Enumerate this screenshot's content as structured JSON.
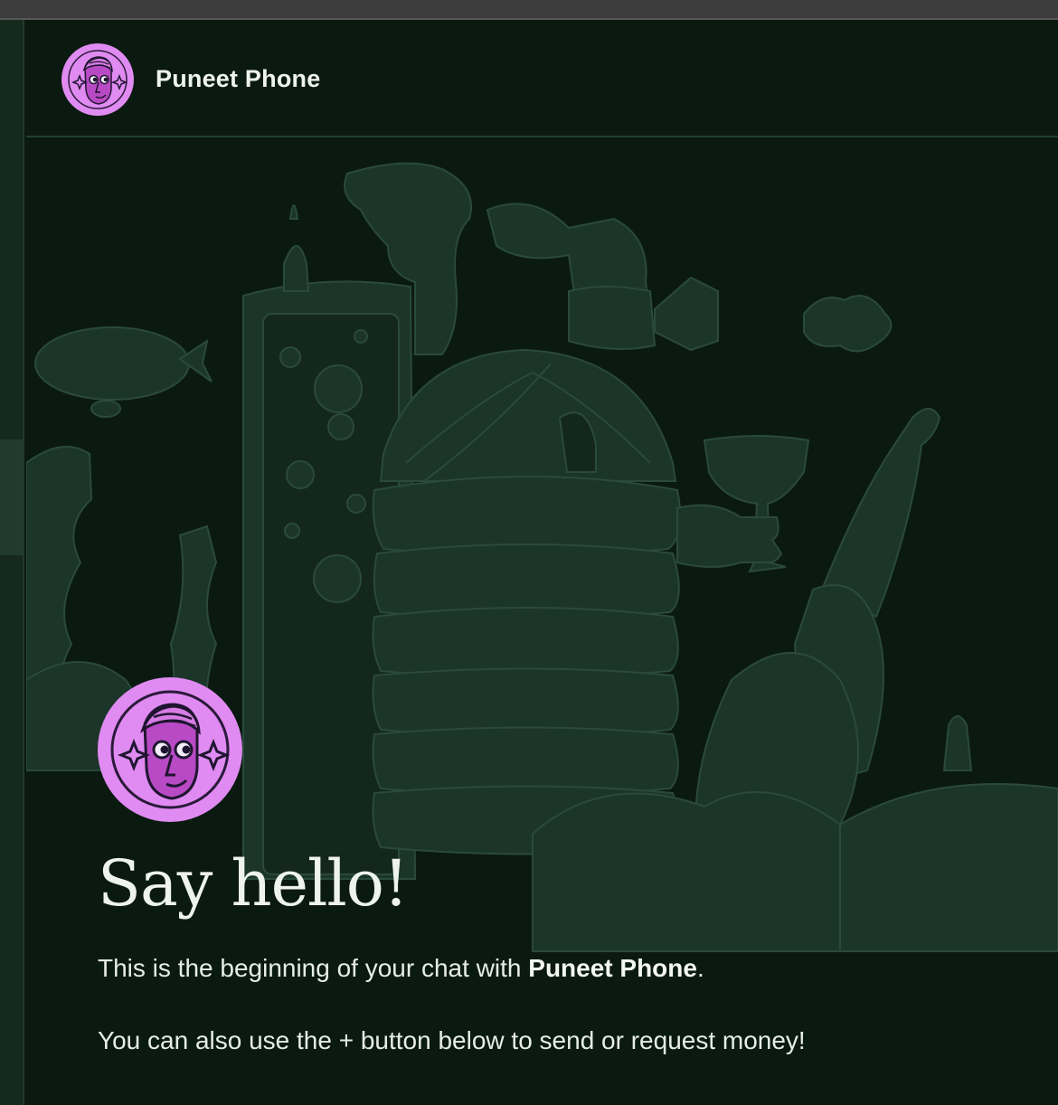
{
  "chat": {
    "contact_name": "Puneet Phone",
    "avatar_icon": "cartoon-face-avatar-icon",
    "avatar_color": "#e08bf1"
  },
  "intro": {
    "title": "Say hello!",
    "line1_prefix": "This is the beginning of your chat with ",
    "line1_name": "Puneet Phone",
    "line1_suffix": ".",
    "line2": "You can also use the + button below to send or request money!"
  },
  "theme": {
    "background": "#0b1a10",
    "illustration": "#1e3a2e",
    "text": "#eef3ef"
  }
}
